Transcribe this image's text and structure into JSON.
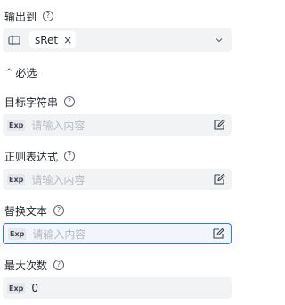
{
  "output": {
    "label": "输出到",
    "tag": "sRet",
    "var_icon": "variable-icon"
  },
  "advanced": {
    "title": "必选"
  },
  "fields": [
    {
      "label": "目标字符串",
      "exp": "Exp",
      "placeholder": "请输入内容",
      "value": ""
    },
    {
      "label": "正则表达式",
      "exp": "Exp",
      "placeholder": "请输入内容",
      "value": ""
    },
    {
      "label": "替换文本",
      "exp": "Exp",
      "placeholder": "请输入内容",
      "value": ""
    },
    {
      "label": "最大次数",
      "exp": "Exp",
      "placeholder": "",
      "value": "0"
    }
  ],
  "colors": {
    "accent": "#3370ff",
    "field_bg": "#f2f3f5"
  }
}
